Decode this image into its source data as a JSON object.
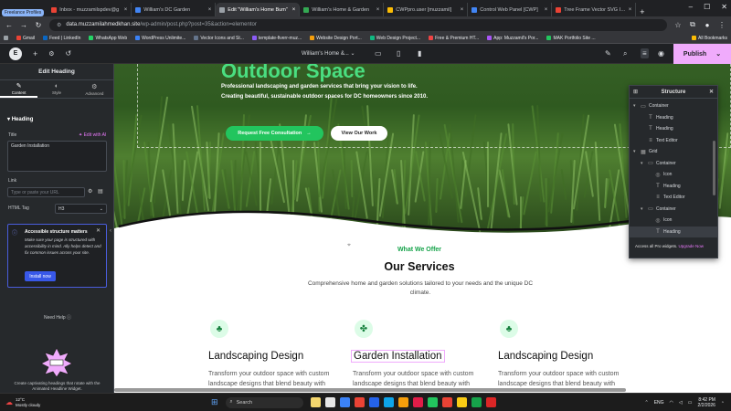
{
  "browser": {
    "profile_chip": "Freelance Profiles",
    "tabs": [
      {
        "title": "Inbox - muzzamilspdev@g",
        "color": "#ea4335",
        "active": false
      },
      {
        "title": "William's DC Garden",
        "color": "#4285f4",
        "active": false
      },
      {
        "title": "Edit \"William's Home Bum\"",
        "color": "#9aa0a6",
        "active": true
      },
      {
        "title": "William's Home & Garden",
        "color": "#34a853",
        "active": false
      },
      {
        "title": "CWPpro.user [muzzamil]",
        "color": "#fbbc04",
        "active": false
      },
      {
        "title": "Control Web Panel [CWP]",
        "color": "#4285f4",
        "active": false
      },
      {
        "title": "Tree Frame Vector SVG Icon",
        "color": "#ea4335",
        "active": false
      }
    ],
    "url_host": "data.muzzamilahmedkhan.site",
    "url_path": "/wp-admin/post.php?post=35&action=elementor",
    "bookmarks": [
      "Gmail",
      "Feed | LinkedIn",
      "WhatsApp Web",
      "WordPress Unlimite...",
      "Vector Icons and St...",
      "template-fiverr-muz...",
      "Website Design Port...",
      "Web Design Project...",
      "Free & Premium HT...",
      "App: Muzzamil's Por...",
      "MAK Portfolio Site ..."
    ],
    "all_bookmarks": "All Bookmarks"
  },
  "elementor": {
    "page_selector": "William's Home &...",
    "publish_label": "Publish",
    "panel": {
      "title": "Edit Heading",
      "tabs": [
        "Content",
        "Style",
        "Advanced"
      ],
      "section": "Heading",
      "title_label": "Title",
      "edit_ai": "Edit with AI",
      "title_value": "Garden Installation",
      "link_label": "Link",
      "link_placeholder": "Type or paste your URL",
      "html_tag_label": "HTML Tag",
      "html_tag_value": "H3",
      "notice_title": "Accessible structure matters",
      "notice_body": "Make sure your page is structured with accessibility in mind. Ally helps detect and fix common issues across your site.",
      "install_label": "Install now",
      "need_help": "Need Help",
      "promo_text": "Create captivating headings that rotate with the Animated Headline Widget."
    },
    "structure": {
      "title": "Structure",
      "items": [
        {
          "label": "Container",
          "icon": "container-icon",
          "depth": 0,
          "caret": "v"
        },
        {
          "label": "Heading",
          "icon": "heading-icon",
          "depth": 1,
          "caret": ""
        },
        {
          "label": "Heading",
          "icon": "heading-icon",
          "depth": 1,
          "caret": ""
        },
        {
          "label": "Text Editor",
          "icon": "text-icon",
          "depth": 1,
          "caret": ""
        },
        {
          "label": "Grid",
          "icon": "grid-icon",
          "depth": 0,
          "caret": "v"
        },
        {
          "label": "Container",
          "icon": "container-icon",
          "depth": 1,
          "caret": "v"
        },
        {
          "label": "Icon",
          "icon": "icon-widget-icon",
          "depth": 2,
          "caret": ""
        },
        {
          "label": "Heading",
          "icon": "heading-icon",
          "depth": 2,
          "caret": ""
        },
        {
          "label": "Text Editor",
          "icon": "text-icon",
          "depth": 2,
          "caret": ""
        },
        {
          "label": "Container",
          "icon": "container-icon",
          "depth": 1,
          "caret": "v"
        },
        {
          "label": "Icon",
          "icon": "icon-widget-icon",
          "depth": 2,
          "caret": ""
        },
        {
          "label": "Heading",
          "icon": "heading-icon",
          "depth": 2,
          "caret": "",
          "active": true
        }
      ],
      "footer": "Access all Pro widgets.",
      "footer_link": "Upgrade Now"
    }
  },
  "site": {
    "hero_title": "Outdoor Space",
    "hero_sub": "Professional landscaping and garden services that bring your vision to life. Creating beautiful, sustainable outdoor spaces for DC homeowners since 2010.",
    "cta_label": "Request Free Consultation",
    "work_label": "View Our Work",
    "section_kicker": "What We Offer",
    "section_title": "Our Services",
    "section_desc": "Comprehensive home and garden solutions tailored to your needs and the unique DC climate.",
    "services": [
      {
        "title": "Landscaping Design",
        "desc": "Transform your outdoor space with custom landscape designs that blend beauty with",
        "icon": "tree-icon"
      },
      {
        "title": "Garden Installation",
        "desc": "Transform your outdoor space with custom landscape designs that blend beauty with",
        "icon": "leaf-icon"
      },
      {
        "title": "Landscaping Design",
        "desc": "Transform your outdoor space with custom landscape designs that blend beauty with",
        "icon": "tree-icon"
      }
    ]
  },
  "taskbar": {
    "weather_temp": "12°C",
    "weather_desc": "Mostly cloudy",
    "search_label": "Search",
    "lang": "ENG",
    "time": "8:42 PM",
    "date": "2/2/2026",
    "app_colors": [
      "#f5d76e",
      "#e6e6e6",
      "#3b82f6",
      "#ea4335",
      "#2563eb",
      "#0ea5e9",
      "#f59e0b",
      "#e11d48",
      "#22c55e",
      "#ea4335",
      "#facc15",
      "#16a34a",
      "#dc2626"
    ]
  }
}
